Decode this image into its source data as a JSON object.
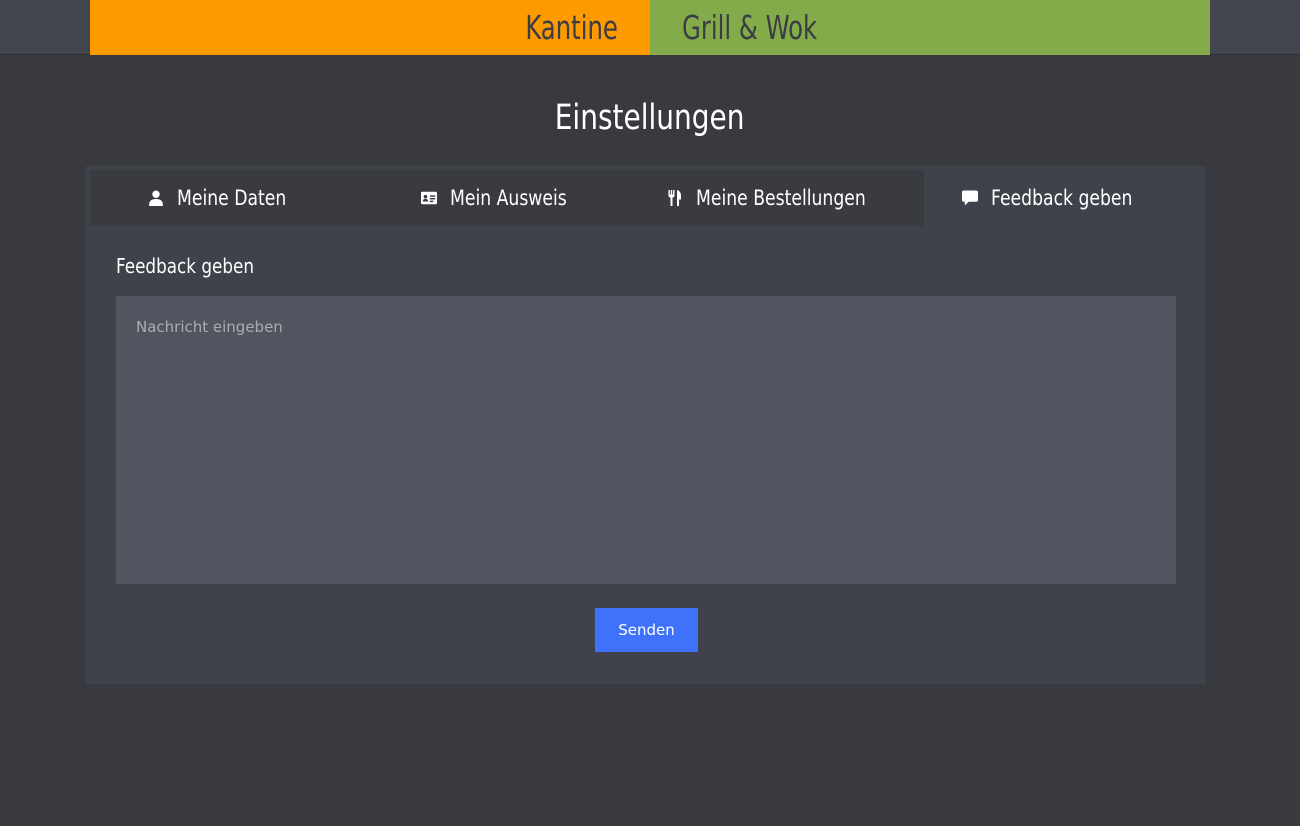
{
  "header": {
    "brand_left": "Kantine",
    "brand_right": "Grill & Wok",
    "colors": {
      "left": "#fd9a00",
      "right": "#84ab4a"
    }
  },
  "page": {
    "title": "Einstellungen"
  },
  "tabs": [
    {
      "label": "Meine Daten",
      "icon": "user-icon",
      "active": false
    },
    {
      "label": "Mein Ausweis",
      "icon": "id-card-icon",
      "active": false
    },
    {
      "label": "Meine Bestellungen",
      "icon": "fork-knife-icon",
      "active": false
    },
    {
      "label": "Feedback geben",
      "icon": "comment-icon",
      "active": true
    }
  ],
  "feedback": {
    "title": "Feedback geben",
    "placeholder": "Nachricht eingeben",
    "value": "",
    "submit_label": "Senden",
    "button_color": "#3f71fb"
  }
}
